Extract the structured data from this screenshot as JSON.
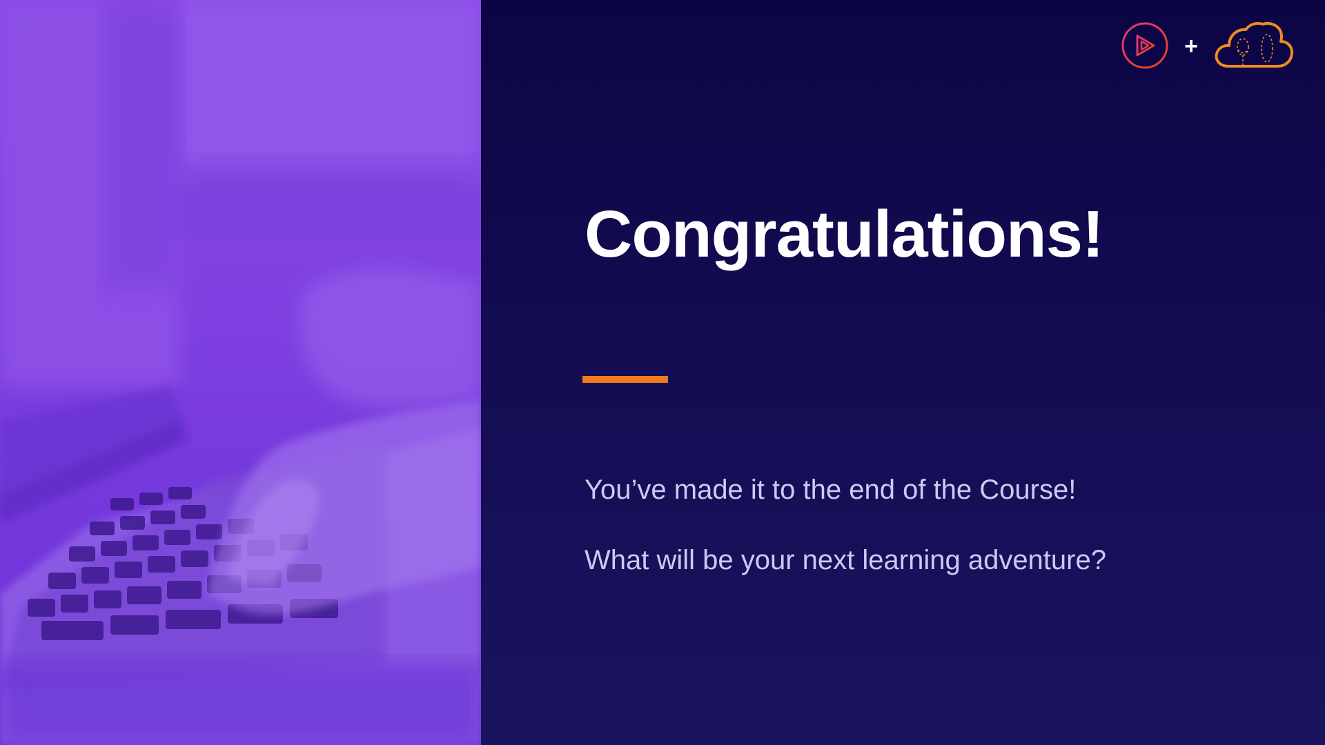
{
  "slide": {
    "title": "Congratulations!",
    "lines": [
      "You’ve made it to the end of the Course!",
      "What will be your next learning adventure?"
    ],
    "logo_separator": "+"
  },
  "icons": {
    "left_logo": "play-circle-logo-icon",
    "right_logo": "cloud-logo-icon"
  },
  "colors": {
    "background": "#0c0544",
    "photo_tint": "#8a4ae6",
    "accent": "#f07a1e",
    "title": "#ffffff",
    "body_text": "#cfc9f2",
    "play_logo": "#e0245e",
    "cloud_logo": "#f08a24"
  }
}
